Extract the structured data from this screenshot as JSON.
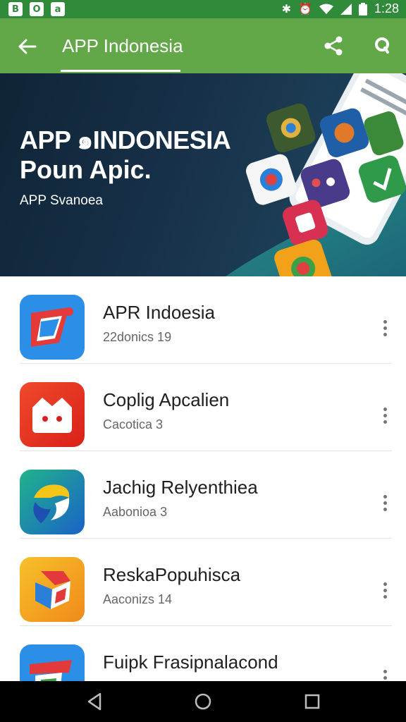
{
  "status_bar": {
    "left_icons": [
      "B",
      "O",
      "a"
    ],
    "time": "1:28",
    "icons": [
      "bluetooth-icon",
      "alarm-icon",
      "wifi-icon",
      "signal-icon",
      "battery-icon"
    ]
  },
  "app_bar": {
    "title": "APP Indonesia",
    "back_icon": "arrow-back-icon",
    "share_icon": "share-icon",
    "search_icon": "search-icon"
  },
  "banner": {
    "title_line1": "APP ๑INDONESIA",
    "title_line2": "Poun Apic.",
    "subtitle": "APP Svanoea"
  },
  "apps": [
    {
      "name": "APR Indoesia",
      "meta": "22donics 19",
      "icon": "app-icon-red-blue"
    },
    {
      "name": "Coplig Apcalien",
      "meta": "Cacotica 3",
      "icon": "app-icon-red-bot"
    },
    {
      "name": "Jachig Relyenthiea",
      "meta": "Aabonioa 3",
      "icon": "app-icon-yellow-blue"
    },
    {
      "name": "ReskaPopuhisca",
      "meta": "Aaconizs 14",
      "icon": "app-icon-orange-blue"
    },
    {
      "name": "Fuipk Frasipnalacond",
      "meta": "",
      "icon": "app-icon-blue-red"
    }
  ],
  "nav_bar": {
    "icons": [
      "back-triangle-icon",
      "home-circle-icon",
      "recents-square-icon"
    ]
  },
  "colors": {
    "status_bar": "#2f8a3a",
    "app_bar": "#62a848",
    "banner_bg": "#173149",
    "text_primary": "#202020",
    "text_secondary": "#666666"
  }
}
